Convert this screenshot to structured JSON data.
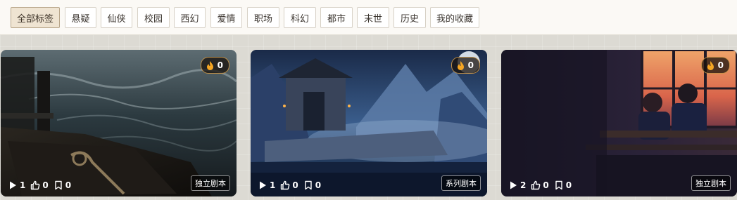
{
  "tags": [
    {
      "label": "全部标签",
      "active": true
    },
    {
      "label": "悬疑"
    },
    {
      "label": "仙侠"
    },
    {
      "label": "校园"
    },
    {
      "label": "西幻"
    },
    {
      "label": "爱情"
    },
    {
      "label": "职场"
    },
    {
      "label": "科幻"
    },
    {
      "label": "都市"
    },
    {
      "label": "末世"
    },
    {
      "label": "历史"
    },
    {
      "label": "我的收藏"
    }
  ],
  "cards": [
    {
      "heat": "0",
      "plays": "1",
      "likes": "0",
      "saves": "0",
      "type": "独立剧本"
    },
    {
      "heat": "0",
      "plays": "1",
      "likes": "0",
      "saves": "0",
      "type": "系列剧本"
    },
    {
      "heat": "0",
      "plays": "2",
      "likes": "0",
      "saves": "0",
      "type": "独立剧本"
    }
  ],
  "icons": {
    "heat": "flame-icon",
    "plays": "play-icon",
    "likes": "thumbs-up-icon",
    "saves": "bookmark-icon"
  },
  "colors": {
    "active_tag_bg": "#efe4d2",
    "tag_bar_bg": "#fbf9f5",
    "flame": "#f5a623"
  }
}
